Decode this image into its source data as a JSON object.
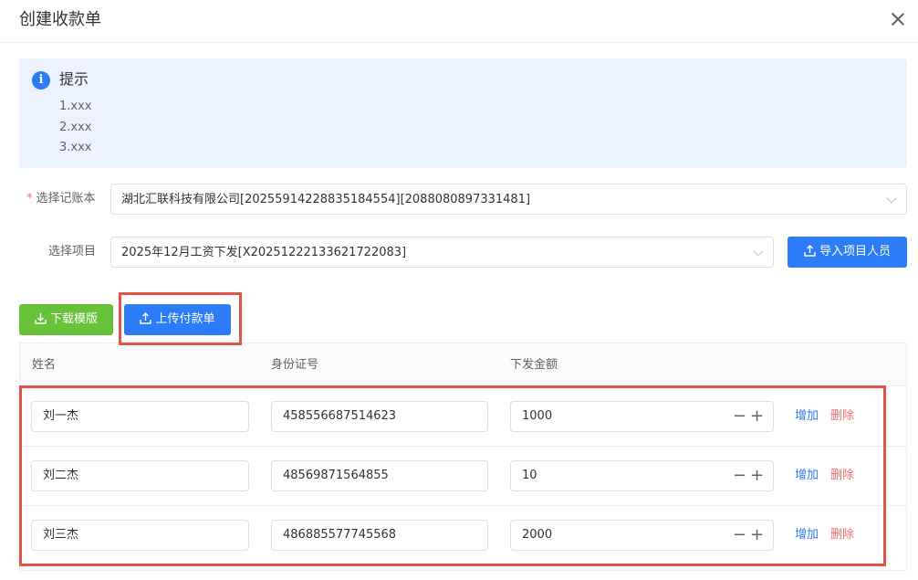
{
  "dialog": {
    "title": "创建收款单"
  },
  "alert": {
    "title": "提示",
    "lines": [
      "1.xxx",
      "2.xxx",
      "3.xxx"
    ]
  },
  "form": {
    "ledger_label": "选择记账本",
    "ledger_value": "湖北汇联科技有限公司[2025591422883518455​4][2088080897331481]",
    "project_label": "选择项目",
    "project_value": "2025年12月工资下发[X20251222133621722083]",
    "import_button": "导入项目人员"
  },
  "toolbar": {
    "download_label": "下载模版",
    "upload_label": "上传付款单"
  },
  "table": {
    "headers": [
      "姓名",
      "身份证号",
      "下发金额"
    ],
    "rows": [
      {
        "name": "刘一杰",
        "id": "458556687514623",
        "amount": "1000"
      },
      {
        "name": "刘二杰",
        "id": "48569871564855",
        "amount": "10"
      },
      {
        "name": "刘三杰",
        "id": "486885577745568",
        "amount": "2000"
      }
    ],
    "add_label": "增加",
    "delete_label": "删除",
    "minus_symbol": "−",
    "plus_symbol": "+"
  },
  "colors": {
    "primary": "#2b7cf6",
    "success": "#67c23a",
    "danger": "#f56c6c",
    "highlight_box": "#e5534b"
  }
}
